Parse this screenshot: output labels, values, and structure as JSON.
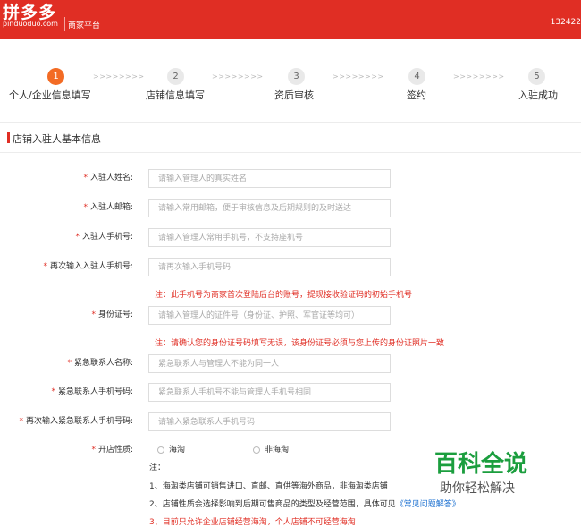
{
  "header": {
    "logo_cn": "拼多多",
    "logo_en": "pinduoduo.com",
    "platform": "商家平台",
    "user": "132422"
  },
  "steps": [
    {
      "num": "1",
      "label": "个人/企业信息填写",
      "active": true
    },
    {
      "num": "2",
      "label": "店铺信息填写",
      "active": false
    },
    {
      "num": "3",
      "label": "资质审核",
      "active": false
    },
    {
      "num": "4",
      "label": "签约",
      "active": false
    },
    {
      "num": "5",
      "label": "入驻成功",
      "active": false
    }
  ],
  "arrows": ">>>>>>>>",
  "section_title": "店铺入驻人基本信息",
  "form": {
    "star": "*",
    "name": {
      "label": "入驻人姓名:",
      "placeholder": "请输入管理人的真实姓名"
    },
    "email": {
      "label": "入驻人邮箱:",
      "placeholder": "请输入常用邮箱，便于审核信息及后期规则的及时送达"
    },
    "phone": {
      "label": "入驻人手机号:",
      "placeholder": "请输入管理人常用手机号，不支持座机号"
    },
    "phone_confirm": {
      "label": "再次输入入驻人手机号:",
      "placeholder": "请再次输入手机号码"
    },
    "phone_note": "注：此手机号为商家首次登陆后台的账号，提现接收验证码的初始手机号",
    "id_number": {
      "label": "身份证号:",
      "placeholder": "请输入管理人的证件号（身份证、护照、军官证等均可）"
    },
    "id_note": "注：请确认您的身份证号码填写无误，该身份证号必须与您上传的身份证照片一致",
    "emergency_name": {
      "label": "紧急联系人名称:",
      "placeholder": "紧急联系人与管理人不能为同一人"
    },
    "emergency_phone": {
      "label": "紧急联系人手机号码:",
      "placeholder": "紧急联系人手机号不能与管理人手机号相同"
    },
    "emergency_phone_confirm": {
      "label": "再次输入紧急联系人手机号码:",
      "placeholder": "请输入紧急联系人手机号码"
    },
    "shop_type": {
      "label": "开店性质:",
      "option1": "海淘",
      "option2": "非海淘"
    },
    "notes_head": "注：",
    "note1": "1、海淘类店铺可销售进口、直邮、直供等海外商品，非海淘类店铺",
    "note2a": "2、店铺性质会选择影响到后期可售商品的类型及经营范围，具体可见",
    "note2b": "《常见问题解答》",
    "note3": "3、目前只允许企业店铺经营海淘，个人店铺不可经营海淘"
  },
  "watermark": {
    "title": "百科全说",
    "subtitle": "助你轻松解决"
  }
}
